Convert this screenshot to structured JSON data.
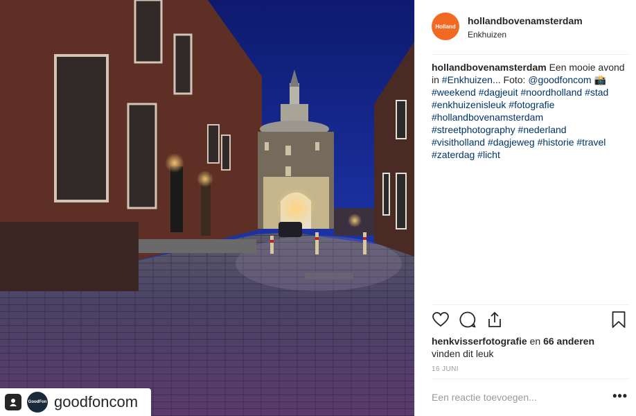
{
  "post": {
    "username": "hollandbovenamsterdam",
    "location": "Enkhuizen",
    "avatar_text": "Holland",
    "brand_color": "#f26a21"
  },
  "photo": {
    "repost_name": "goodfoncom",
    "repost_avatar_text": "GoodFon"
  },
  "caption": {
    "username": "hollandbovenamsterdam",
    "text_1": " Een mooie avond in ",
    "tag_enkhuizen": "#Enkhuizen",
    "text_2": "... Foto: ",
    "mention": "@goodfoncom",
    "emoji": " 📸",
    "tags": [
      "#weekend",
      "#dagjeuit",
      "#noordholland",
      "#stad",
      "#enkhuizenisleuk",
      "#fotografie",
      "#hollandbovenamsterdam",
      "#streetphotography",
      "#nederland",
      "#visitholland",
      "#dagjeweg",
      "#historie",
      "#travel",
      "#zaterdag",
      "#licht"
    ]
  },
  "likes": {
    "user": "henkvisserfotografie",
    "middle": " en ",
    "others": "66 anderen",
    "suffix": "vinden dit leuk"
  },
  "date": "16 JUNI",
  "comment": {
    "placeholder": "Een reactie toevoegen..."
  },
  "more_label": "•••",
  "icons": [
    "heart-icon",
    "comment-icon",
    "share-icon",
    "bookmark-icon"
  ]
}
